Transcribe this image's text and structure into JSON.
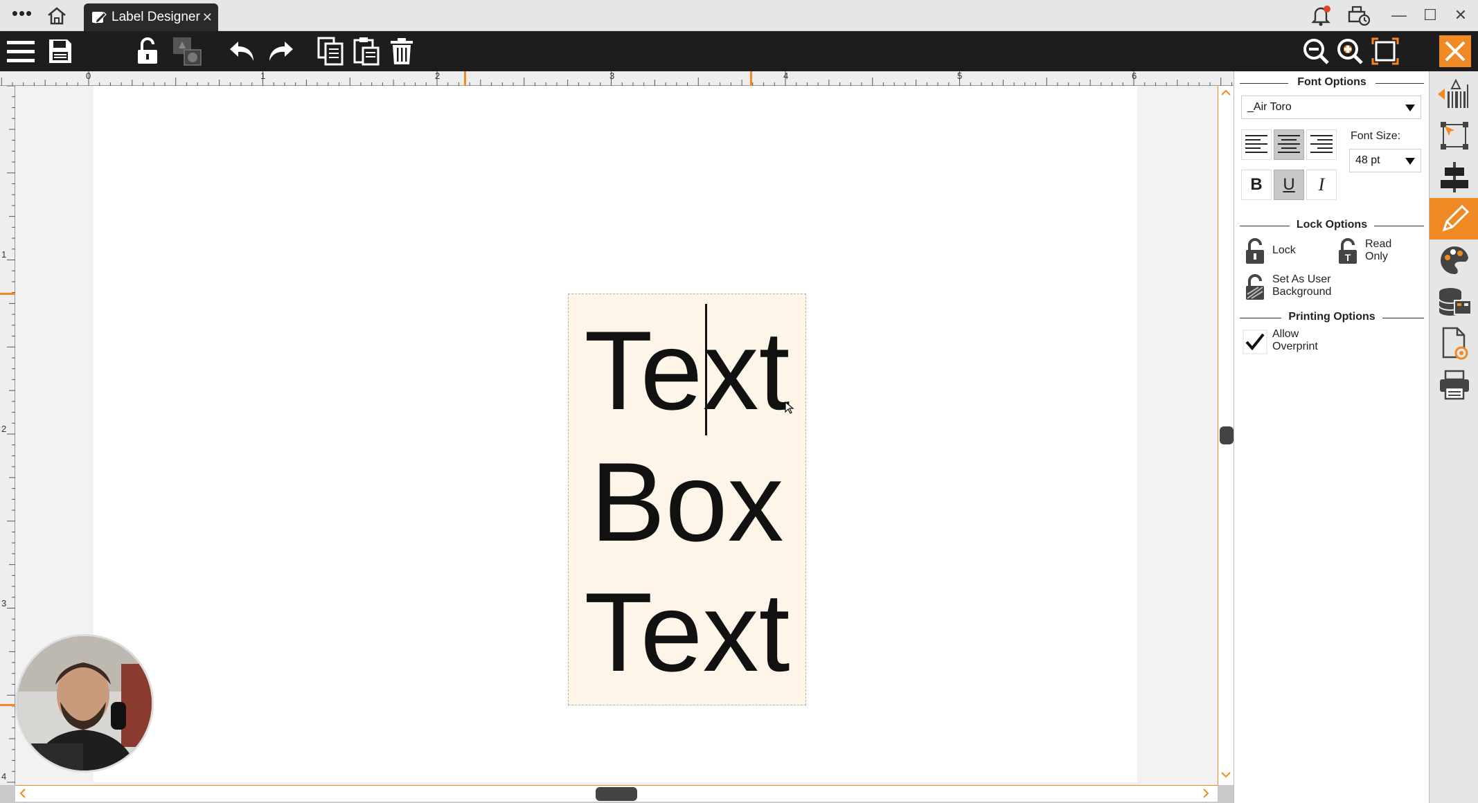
{
  "titlebar": {
    "menu_dots": "•••",
    "tab_label": "Label Designer",
    "tab_close": "✕",
    "window_minimize": "—",
    "window_maximize": "☐",
    "window_close": "✕"
  },
  "toolbar": {
    "icons": [
      "menu-icon",
      "save-icon",
      "unlock-icon",
      "layer-icon",
      "undo-icon",
      "redo-icon",
      "copy-icon",
      "paste-icon",
      "delete-icon",
      "zoom-out-icon",
      "zoom-in-icon",
      "fit-page-icon",
      "close-icon"
    ]
  },
  "ruler": {
    "top_numbers": [
      "0",
      "1",
      "2",
      "3",
      "4",
      "5",
      "6"
    ],
    "left_numbers": [
      "1",
      "2",
      "3",
      "4"
    ]
  },
  "canvas": {
    "text_lines": [
      "Text",
      "Box",
      "Text"
    ]
  },
  "props": {
    "font_options_title": "Font Options",
    "font_name": "_Air Toro",
    "font_size_label": "Font Size:",
    "font_size_value": "48 pt",
    "bold_label": "B",
    "underline_label": "U",
    "italic_label": "I",
    "lock_options_title": "Lock Options",
    "lock_label": "Lock",
    "read_only_label_1": "Read",
    "read_only_label_2": "Only",
    "user_bg_label_1": "Set As User",
    "user_bg_label_2": "Background",
    "printing_options_title": "Printing Options",
    "overprint_label_1": "Allow",
    "overprint_label_2": "Overprint",
    "overprint_checked": true
  },
  "sidebar": {
    "icons": [
      "barcode-icon",
      "shape-select-icon",
      "align-icon",
      "text-edit-icon",
      "palette-icon",
      "database-icon",
      "page-settings-icon",
      "print-icon"
    ],
    "active": "text-edit-icon"
  },
  "colors": {
    "accent": "#f08a24",
    "toolbar_bg": "#1d1d1d",
    "textbox_bg": "#fdf6e8"
  }
}
